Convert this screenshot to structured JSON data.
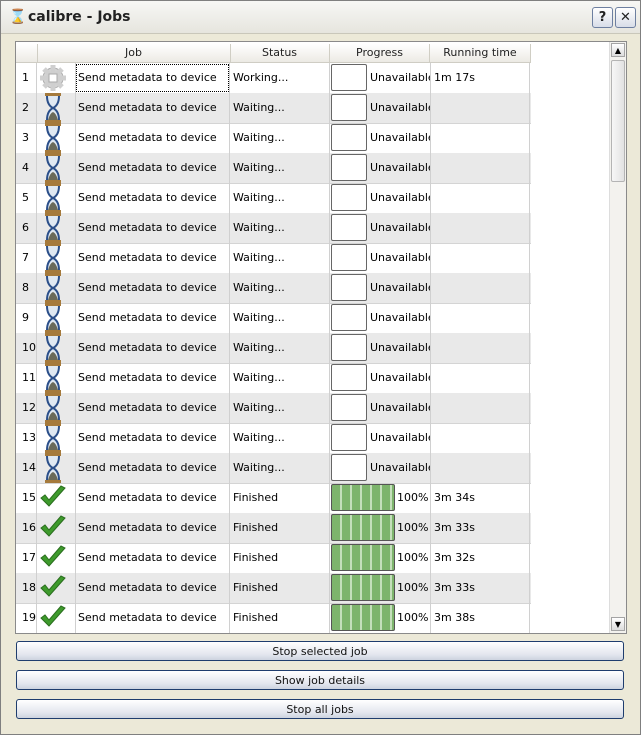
{
  "window": {
    "title": "calibre - Jobs",
    "help_label": "?",
    "close_label": "✕"
  },
  "table": {
    "columns": [
      "",
      "Job",
      "Status",
      "Progress",
      "Running time"
    ],
    "rows": [
      {
        "num": "1",
        "icon": "gear-icon",
        "job": "Send metadata to device",
        "status": "Working...",
        "progress": null,
        "progress_text": "Unavailable",
        "time": "1m 17s"
      },
      {
        "num": "2",
        "icon": "hourglass-icon",
        "job": "Send metadata to device",
        "status": "Waiting...",
        "progress": null,
        "progress_text": "Unavailable",
        "time": ""
      },
      {
        "num": "3",
        "icon": "hourglass-icon",
        "job": "Send metadata to device",
        "status": "Waiting...",
        "progress": null,
        "progress_text": "Unavailable",
        "time": ""
      },
      {
        "num": "4",
        "icon": "hourglass-icon",
        "job": "Send metadata to device",
        "status": "Waiting...",
        "progress": null,
        "progress_text": "Unavailable",
        "time": ""
      },
      {
        "num": "5",
        "icon": "hourglass-icon",
        "job": "Send metadata to device",
        "status": "Waiting...",
        "progress": null,
        "progress_text": "Unavailable",
        "time": ""
      },
      {
        "num": "6",
        "icon": "hourglass-icon",
        "job": "Send metadata to device",
        "status": "Waiting...",
        "progress": null,
        "progress_text": "Unavailable",
        "time": ""
      },
      {
        "num": "7",
        "icon": "hourglass-icon",
        "job": "Send metadata to device",
        "status": "Waiting...",
        "progress": null,
        "progress_text": "Unavailable",
        "time": ""
      },
      {
        "num": "8",
        "icon": "hourglass-icon",
        "job": "Send metadata to device",
        "status": "Waiting...",
        "progress": null,
        "progress_text": "Unavailable",
        "time": ""
      },
      {
        "num": "9",
        "icon": "hourglass-icon",
        "job": "Send metadata to device",
        "status": "Waiting...",
        "progress": null,
        "progress_text": "Unavailable",
        "time": ""
      },
      {
        "num": "10",
        "icon": "hourglass-icon",
        "job": "Send metadata to device",
        "status": "Waiting...",
        "progress": null,
        "progress_text": "Unavailable",
        "time": ""
      },
      {
        "num": "11",
        "icon": "hourglass-icon",
        "job": "Send metadata to device",
        "status": "Waiting...",
        "progress": null,
        "progress_text": "Unavailable",
        "time": ""
      },
      {
        "num": "12",
        "icon": "hourglass-icon",
        "job": "Send metadata to device",
        "status": "Waiting...",
        "progress": null,
        "progress_text": "Unavailable",
        "time": ""
      },
      {
        "num": "13",
        "icon": "hourglass-icon",
        "job": "Send metadata to device",
        "status": "Waiting...",
        "progress": null,
        "progress_text": "Unavailable",
        "time": ""
      },
      {
        "num": "14",
        "icon": "hourglass-icon",
        "job": "Send metadata to device",
        "status": "Waiting...",
        "progress": null,
        "progress_text": "Unavailable",
        "time": ""
      },
      {
        "num": "15",
        "icon": "checkmark-icon",
        "job": "Send metadata to device",
        "status": "Finished",
        "progress": 100,
        "progress_text": "100%",
        "time": "3m 34s"
      },
      {
        "num": "16",
        "icon": "checkmark-icon",
        "job": "Send metadata to device",
        "status": "Finished",
        "progress": 100,
        "progress_text": "100%",
        "time": "3m 33s"
      },
      {
        "num": "17",
        "icon": "checkmark-icon",
        "job": "Send metadata to device",
        "status": "Finished",
        "progress": 100,
        "progress_text": "100%",
        "time": "3m 32s"
      },
      {
        "num": "18",
        "icon": "checkmark-icon",
        "job": "Send metadata to device",
        "status": "Finished",
        "progress": 100,
        "progress_text": "100%",
        "time": "3m 33s"
      },
      {
        "num": "19",
        "icon": "checkmark-icon",
        "job": "Send metadata to device",
        "status": "Finished",
        "progress": 100,
        "progress_text": "100%",
        "time": "3m 38s"
      }
    ]
  },
  "buttons": {
    "stop_selected": "Stop selected job",
    "show_details": "Show job details",
    "stop_all": "Stop all jobs"
  },
  "colors": {
    "progress_fill": "#7db46c",
    "check": "#3e9a2c",
    "button_border": "#1f3d6e"
  }
}
